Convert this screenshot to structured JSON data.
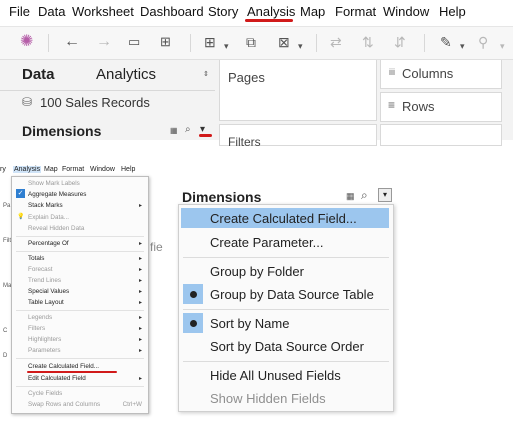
{
  "menubar": {
    "items": [
      "File",
      "Data",
      "Worksheet",
      "Dashboard",
      "Story",
      "Analysis",
      "Map",
      "Format",
      "Window",
      "Help"
    ]
  },
  "top_panel": {
    "data_tab": "Data",
    "analytics_tab": "Analytics",
    "pages_label": "Pages",
    "columns_label": "Columns",
    "rows_label": "Rows",
    "data_source": "100 Sales Records",
    "dimensions_label": "Dimensions",
    "filters_label": "Filters"
  },
  "small_menubar": {
    "items": [
      "ry",
      "Analysis",
      "Map",
      "Format",
      "Window",
      "Help"
    ]
  },
  "analysis_menu": {
    "items": [
      {
        "label": "Show Mark Labels",
        "enabled": false,
        "submenu": false
      },
      {
        "label": "Aggregate Measures",
        "enabled": true,
        "submenu": false,
        "checked": true
      },
      {
        "label": "Stack Marks",
        "enabled": true,
        "submenu": true
      },
      {
        "label": "Explain Data...",
        "enabled": false,
        "submenu": false
      },
      {
        "label": "Reveal Hidden Data",
        "enabled": false,
        "submenu": false
      },
      {
        "label": "Percentage Of",
        "enabled": true,
        "submenu": true
      },
      {
        "label": "Totals",
        "enabled": true,
        "submenu": true
      },
      {
        "label": "Forecast",
        "enabled": false,
        "submenu": true
      },
      {
        "label": "Trend Lines",
        "enabled": false,
        "submenu": true
      },
      {
        "label": "Special Values",
        "enabled": true,
        "submenu": true
      },
      {
        "label": "Table Layout",
        "enabled": true,
        "submenu": true
      },
      {
        "label": "Legends",
        "enabled": false,
        "submenu": true
      },
      {
        "label": "Filters",
        "enabled": false,
        "submenu": true
      },
      {
        "label": "Highlighters",
        "enabled": false,
        "submenu": true
      },
      {
        "label": "Parameters",
        "enabled": false,
        "submenu": true
      },
      {
        "label": "Create Calculated Field...",
        "enabled": true,
        "submenu": false
      },
      {
        "label": "Edit Calculated Field",
        "enabled": true,
        "submenu": true
      },
      {
        "label": "Cycle Fields",
        "enabled": false,
        "submenu": false
      },
      {
        "label": "Swap Rows and Columns",
        "enabled": false,
        "submenu": false,
        "shortcut": "Ctrl+W"
      }
    ],
    "side_fragments": [
      "Pa",
      "Filt",
      "Ma",
      "C",
      "D"
    ],
    "partial_text": "fie"
  },
  "dimensions_menu": {
    "header": "Dimensions",
    "items": [
      {
        "label": "Create Calculated Field...",
        "highlighted": true
      },
      {
        "label": "Create Parameter..."
      },
      {
        "label": "Group by Folder"
      },
      {
        "label": "Group by Data Source Table",
        "selected": true
      },
      {
        "label": "Sort by Name",
        "selected": true
      },
      {
        "label": "Sort by Data Source Order"
      },
      {
        "label": "Hide All Unused Fields"
      },
      {
        "label": "Show Hidden Fields",
        "disabled": true
      }
    ]
  },
  "colors": {
    "highlight": "#9cc6ee",
    "underline_red": "#d11a1a"
  }
}
